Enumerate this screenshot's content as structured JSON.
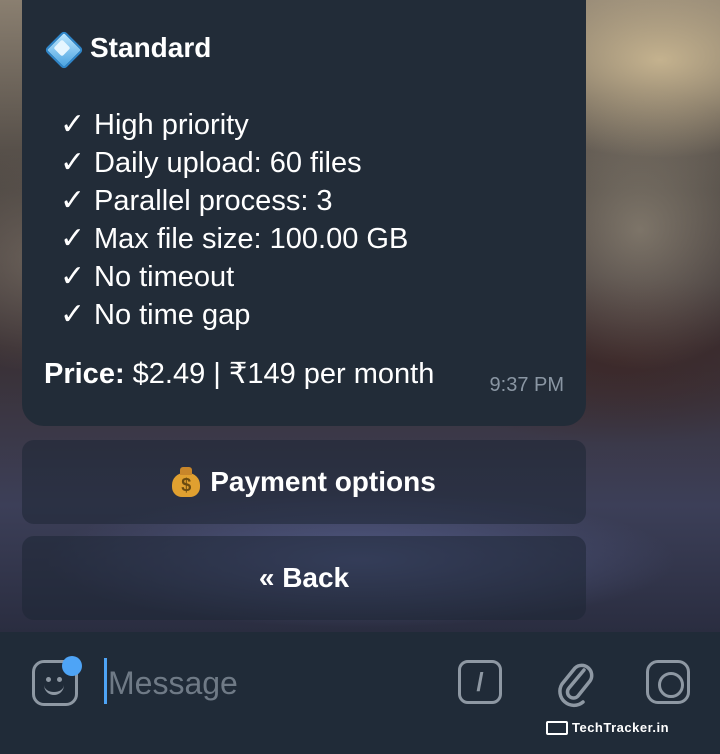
{
  "message": {
    "plan_name": "Standard",
    "features": [
      "High priority",
      "Daily upload: 60 files",
      "Parallel process: 3",
      "Max file size: 100.00 GB",
      "No timeout",
      "No time gap"
    ],
    "check_glyph": "✓",
    "price_label": "Price:",
    "price_value": "$2.49 | ₹149 per month",
    "timestamp": "9:37 PM"
  },
  "keyboard": {
    "payment_label": "Payment options",
    "back_label": "« Back"
  },
  "input": {
    "placeholder": "Message"
  },
  "watermark": "TechTracker.in",
  "icons": {
    "plan": "diamond-icon",
    "payment": "money-bag-icon",
    "sticker": "sticker-icon",
    "command": "slash-command-icon",
    "attach": "paperclip-icon",
    "camera": "camera-icon"
  },
  "colors": {
    "bubble": "#222c38",
    "input_bar": "#202b38",
    "accent": "#4ea4f6",
    "timestamp": "#8a96a3",
    "icon": "#8e98a3"
  }
}
